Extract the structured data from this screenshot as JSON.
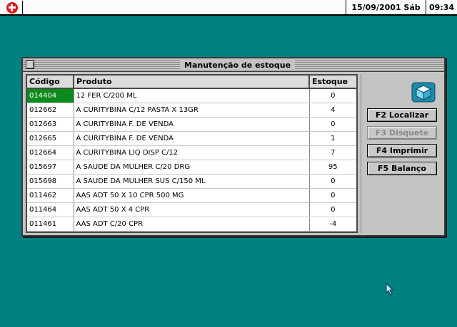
{
  "topbar": {
    "date": "15/09/2001 Sáb",
    "time": "09:34",
    "system_icon": "system-menu-icon"
  },
  "dialog": {
    "title": "Manutenção de estoque",
    "table": {
      "headers": [
        "Código",
        "Produto",
        "Estoque"
      ],
      "selected_row": 0,
      "rows": [
        {
          "codigo": "014404",
          "produto": "12 FER C/200 ML",
          "estoque": "0"
        },
        {
          "codigo": "012662",
          "produto": "A CURITYBINA C/12 PASTA X 13GR",
          "estoque": "4"
        },
        {
          "codigo": "012663",
          "produto": "A CURITYBINA F. DE VENDA",
          "estoque": "0"
        },
        {
          "codigo": "012665",
          "produto": "A CURITYBINA F. DE VENDA",
          "estoque": "1"
        },
        {
          "codigo": "012664",
          "produto": "A CURITYBINA LIQ DISP C/12",
          "estoque": "7"
        },
        {
          "codigo": "015697",
          "produto": "A SAUDE DA MULHER C/20 DRG",
          "estoque": "95"
        },
        {
          "codigo": "015698",
          "produto": "A SAUDE DA MULHER SUS C/150 ML",
          "estoque": "0"
        },
        {
          "codigo": "011462",
          "produto": "AAS ADT 50 X 10 CPR 500 MG",
          "estoque": "0"
        },
        {
          "codigo": "011464",
          "produto": "AAS ADT 50 X 4 CPR",
          "estoque": "0"
        },
        {
          "codigo": "011461",
          "produto": "AAS ADT C/20 CPR",
          "estoque": "-4"
        }
      ]
    },
    "buttons": {
      "localizar": "F2 Localizar",
      "disquete": "F3 Disquete",
      "imprimir": "F4 Imprimir",
      "balanco": "F5 Balanço"
    },
    "icon": "cube-icon"
  },
  "colors": {
    "desktop": "#008080",
    "selection": "#0a8a1a",
    "window": "#c4c4c4"
  }
}
